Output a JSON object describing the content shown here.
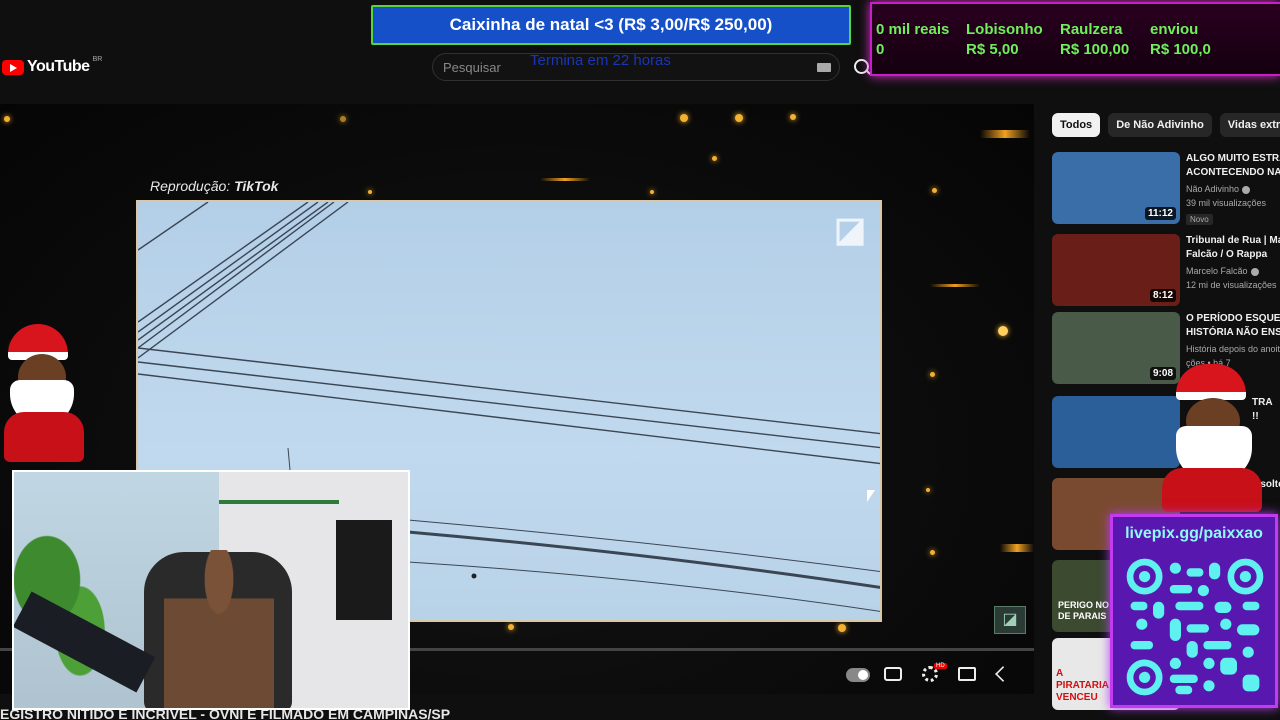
{
  "header": {
    "logo_text": "YouTube",
    "country_code": "BR",
    "search_placeholder": "Pesquisar"
  },
  "donation": {
    "banner_text": "Caixinha de natal <3 (R$ 3,00/R$ 250,00)",
    "timer_text": "Termina em 22 horas"
  },
  "ticker": {
    "items": [
      {
        "top": "0 mil reais",
        "bottom": "0"
      },
      {
        "top": "Lobisonho",
        "bottom": "R$ 5,00"
      },
      {
        "top": "Raulzera",
        "bottom": "R$ 100,00"
      },
      {
        "top": "enviou",
        "bottom": "R$ 100,0"
      }
    ]
  },
  "player": {
    "caption_prefix": "Reprodução:",
    "caption_source": "TikTok",
    "title_strip": "EGISTRO NÍTIDO E INCRÍVEL - OVNI É FILMADO EM CAMPINAS/SP",
    "hd_badge": "HD",
    "progress": 0.0
  },
  "sidebar": {
    "chips": [
      "Todos",
      "De Não Adivinho",
      "Vidas extrate"
    ],
    "videos": [
      {
        "title1": "ALGO MUITO ESTRA",
        "title2": "ACONTECENDO NA",
        "channel": "Não Adivinho",
        "meta": "39 mil visualizações",
        "duration": "11:12",
        "badge": "Novo",
        "thumb_color": "#3a6ea8"
      },
      {
        "title1": "Tribunal de Rua | Ma",
        "title2": "Falcão / O Rappa",
        "channel": "Marcelo Falcão",
        "meta": "12 mi de visualizações",
        "duration": "8:12",
        "badge": "",
        "thumb_color": "#6a1e18"
      },
      {
        "title1": "O PERÍODO ESQUEC",
        "title2": "HISTÓRIA NÃO ENS",
        "channel": "História depois do anoit",
        "meta": "ções • há 7",
        "duration": "9:08",
        "badge": "",
        "thumb_color": "#4a5a48"
      },
      {
        "title1": "TRA",
        "title2": "!!",
        "channel": "",
        "meta": "",
        "duration": "",
        "badge": "",
        "thumb_color": "#2b5f9a"
      },
      {
        "title1": "",
        "title2": "e soltei",
        "channel": "",
        "meta": "",
        "duration": "",
        "badge": "",
        "thumb_color": "#7a4a30"
      },
      {
        "title1": "",
        "title2": "",
        "channel": "",
        "meta": "",
        "duration": "",
        "badge": "",
        "thumb_color": "#3c4a30",
        "overlay": "PERIGO NO DE PARAIS"
      },
      {
        "title1": "",
        "title2": "",
        "channel": "",
        "meta": "",
        "duration": "",
        "badge": "",
        "thumb_color": "#e8e8e8",
        "overlay": "A PIRATARIA VENCEU"
      }
    ]
  },
  "livepix": {
    "label": "livepix.gg/paixxao"
  },
  "colors": {
    "youtube_red": "#ff0000",
    "donation_blue": "#1650c8",
    "ticker_green": "#6ff05a",
    "neon_magenta": "#c81ec8",
    "qr_cyan": "#8ff8f8"
  }
}
